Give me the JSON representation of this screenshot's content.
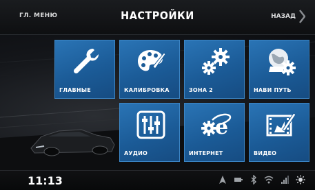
{
  "header": {
    "menu_label": "ГЛ. МЕНЮ",
    "title": "НАСТРОЙКИ",
    "back_label": "НАЗАД"
  },
  "tiles": [
    {
      "label": "ГЛАВНЫЕ",
      "icon": "wrench-icon"
    },
    {
      "label": "КАЛИБРОВКА",
      "icon": "palette-icon"
    },
    {
      "label": "ЗОНА 2",
      "icon": "gears-icon"
    },
    {
      "label": "НАВИ ПУТЬ",
      "icon": "globe-gear-icon"
    },
    {
      "label": "АУДИО",
      "icon": "equalizer-icon"
    },
    {
      "label": "ИНТЕРНЕТ",
      "icon": "internet-explorer-icon"
    },
    {
      "label": "ВИДЕО",
      "icon": "film-edit-icon"
    }
  ],
  "status_bar": {
    "time": "11:13",
    "icons": [
      "navigation-arrow-icon",
      "battery-icon",
      "bluetooth-icon",
      "wifi-icon",
      "signal-icon",
      "brightness-icon"
    ]
  },
  "colors": {
    "tile_blue": "#1f65a4",
    "bar_dark": "#0e0f11",
    "text_white": "#ffffff"
  }
}
